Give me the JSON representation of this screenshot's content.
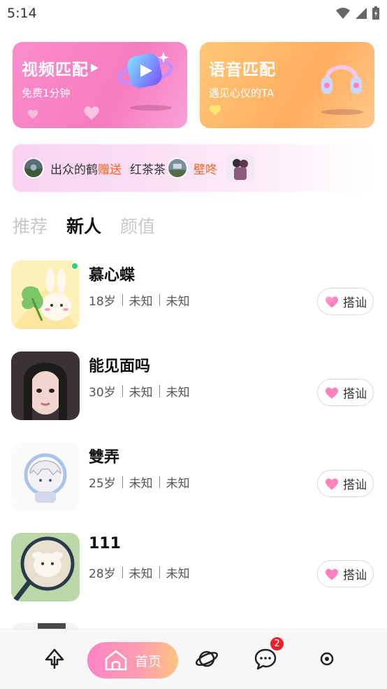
{
  "status_bar": {
    "time": "5:14"
  },
  "match_cards": {
    "video": {
      "title": "视频匹配",
      "subtitle": "免费1分钟"
    },
    "voice": {
      "title": "语音匹配",
      "subtitle": "遇见心仪的TA"
    }
  },
  "gift_banner": {
    "sender": "出众的鹤",
    "action": "赠送",
    "receiver": "红茶茶",
    "gift": "壁咚"
  },
  "tabs": [
    {
      "label": "推荐",
      "active": false
    },
    {
      "label": "新人",
      "active": true
    },
    {
      "label": "颜值",
      "active": false
    }
  ],
  "users": [
    {
      "name": "慕心蝶",
      "age": "18岁",
      "attr1": "未知",
      "attr2": "未知",
      "online": true,
      "button": "搭讪"
    },
    {
      "name": "能见面吗",
      "age": "30岁",
      "attr1": "未知",
      "attr2": "未知",
      "online": false,
      "button": "搭讪"
    },
    {
      "name": "雙弄",
      "age": "25岁",
      "attr1": "未知",
      "attr2": "未知",
      "online": false,
      "button": "搭讪"
    },
    {
      "name": "111",
      "age": "28岁",
      "attr1": "未知",
      "attr2": "未知",
      "online": false,
      "button": "搭讪"
    }
  ],
  "bottom_nav": {
    "home_label": "首页",
    "message_badge": "2",
    "icons": [
      "tree-icon",
      "home-icon",
      "planet-icon",
      "chat-icon",
      "profile-icon"
    ]
  },
  "colors": {
    "video_card": "#f57bbf",
    "voice_card": "#ffad5e",
    "gift_text": "#f5641e",
    "online": "#2bd27a",
    "badge": "#f01e2c"
  }
}
